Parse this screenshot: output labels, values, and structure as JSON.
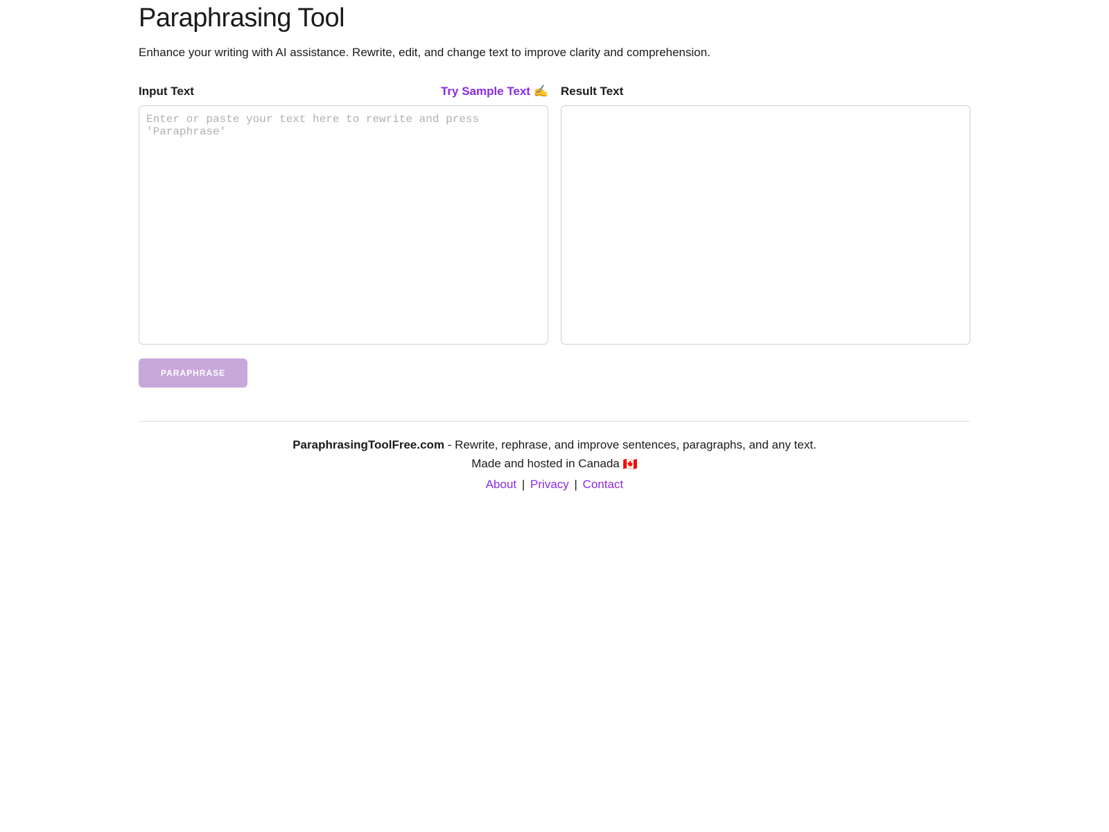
{
  "header": {
    "title": "Paraphrasing Tool",
    "subtitle": "Enhance your writing with AI assistance. Rewrite, edit, and change text to improve clarity and comprehension."
  },
  "input_panel": {
    "label": "Input Text",
    "sample_link": "Try Sample Text",
    "sample_icon": "✍️",
    "placeholder": "Enter or paste your text here to rewrite and press 'Paraphrase'",
    "value": ""
  },
  "result_panel": {
    "label": "Result Text",
    "value": ""
  },
  "actions": {
    "paraphrase_label": "PARAPHRASE"
  },
  "footer": {
    "site_name": "ParaphrasingToolFree.com",
    "tagline": " - Rewrite, rephrase, and improve sentences, paragraphs, and any text.",
    "hosting": "Made and hosted in Canada ",
    "flag": "🇨🇦",
    "links": {
      "about": "About",
      "privacy": "Privacy",
      "contact": "Contact"
    }
  }
}
